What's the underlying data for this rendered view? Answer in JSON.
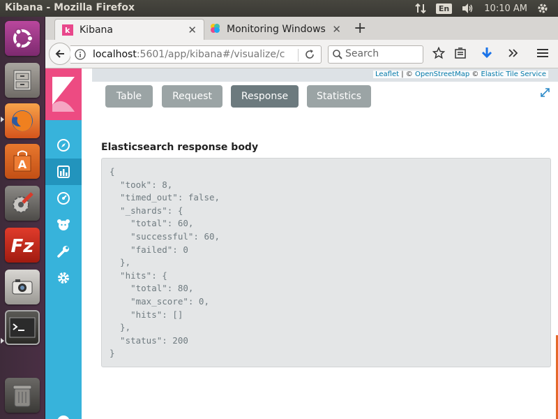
{
  "topbar": {
    "window_title": "Kibana - Mozilla Firefox",
    "keyboard_layout": "En",
    "time": "10:10 AM"
  },
  "launcher": {
    "apps": [
      "ubuntu-dash",
      "files",
      "firefox",
      "software-center",
      "system-settings",
      "filezilla",
      "camera",
      "terminal",
      "trash",
      "media"
    ]
  },
  "browser": {
    "tabs": [
      {
        "label": "Kibana",
        "active": true
      },
      {
        "label": "Monitoring Windows I",
        "active": false
      }
    ],
    "url_host": "localhost",
    "url_rest": ":5601/app/kibana#/visualize/c",
    "search_placeholder": "Search"
  },
  "kibana": {
    "nav_items": [
      "discover",
      "visualize",
      "dashboard",
      "timelion",
      "dev-tools",
      "management"
    ],
    "map_attribution": {
      "leaflet": "Leaflet",
      "sep1": " | © ",
      "osm": "OpenStreetMap",
      "sep2": " © ",
      "elastic": "Elastic Tile Service"
    },
    "inspector_tabs": [
      {
        "label": "Table",
        "selected": false
      },
      {
        "label": "Request",
        "selected": false
      },
      {
        "label": "Response",
        "selected": true
      },
      {
        "label": "Statistics",
        "selected": false
      }
    ],
    "response_title": "Elasticsearch response body",
    "response_body": "{\n  \"took\": 8,\n  \"timed_out\": false,\n  \"_shards\": {\n    \"total\": 60,\n    \"successful\": 60,\n    \"failed\": 0\n  },\n  \"hits\": {\n    \"total\": 80,\n    \"max_score\": 0,\n    \"hits\": []\n  },\n  \"status\": 200\n}"
  },
  "colors": {
    "kibana_pink": "#ed4b82",
    "kibana_nav": "#37b3db",
    "tab_selected": "#6c7a7e",
    "tab_default": "#9ba4a5"
  }
}
